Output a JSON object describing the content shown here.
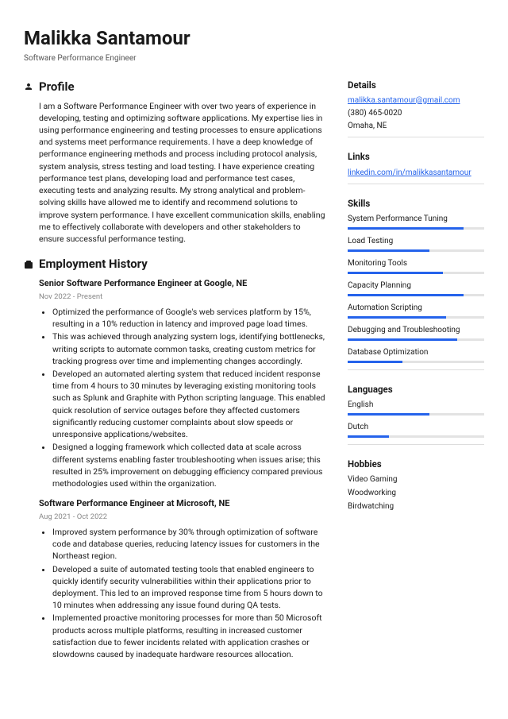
{
  "header": {
    "name": "Malikka Santamour",
    "title": "Software Performance Engineer"
  },
  "profile": {
    "heading": "Profile",
    "text": "I am a Software Performance Engineer with over two years of experience in developing, testing and optimizing software applications. My expertise lies in using performance engineering and testing processes to ensure applications and systems meet performance requirements. I have a deep knowledge of performance engineering methods and process including protocol analysis, system analysis, stress testing and load testing. I have experience creating performance test plans, developing load and performance test cases, executing tests and analyzing results. My strong analytical and problem-solving skills have allowed me to identify and recommend solutions to improve system performance. I have excellent communication skills, enabling me to effectively collaborate with developers and other stakeholders to ensure successful performance testing."
  },
  "employment": {
    "heading": "Employment History",
    "jobs": [
      {
        "title": "Senior Software Performance Engineer at Google, NE",
        "dates": "Nov 2022 - Present",
        "bullets": [
          "Optimized the performance of Google's web services platform by 15%, resulting in a 10% reduction in latency and improved page load times.",
          "This was achieved through analyzing system logs, identifying bottlenecks, writing scripts to automate common tasks, creating custom metrics for tracking progress over time and implementing changes accordingly.",
          "Developed an automated alerting system that reduced incident response time from 4 hours to 30 minutes by leveraging existing monitoring tools such as Splunk and Graphite with Python scripting language. This enabled quick resolution of service outages before they affected customers significantly reducing customer complaints about slow speeds or unresponsive applications/websites.",
          "Designed a logging framework which collected data at scale across different systems enabling faster troubleshooting when issues arise; this resulted in 25% improvement on debugging efficiency compared previous methodologies used within the organization."
        ]
      },
      {
        "title": "Software Performance Engineer at Microsoft, NE",
        "dates": "Aug 2021 - Oct 2022",
        "bullets": [
          "Improved system performance by 30% through optimization of software code and database queries, reducing latency issues for customers in the Northeast region.",
          "Developed a suite of automated testing tools that enabled engineers to quickly identify security vulnerabilities within their applications prior to deployment. This led to an improved response time from 5 hours down to 10 minutes when addressing any issue found during QA tests.",
          "Implemented proactive monitoring processes for more than 50 Microsoft products across multiple platforms, resulting in increased customer satisfaction due to fewer incidents related with application crashes or slowdowns caused by inadequate hardware resources allocation."
        ]
      }
    ]
  },
  "details": {
    "heading": "Details",
    "email": "malikka.santamour@gmail.com",
    "phone": "(380) 465-0020",
    "location": "Omaha, NE"
  },
  "links": {
    "heading": "Links",
    "items": [
      {
        "text": "linkedin.com/in/malikkasantamour"
      }
    ]
  },
  "skills": {
    "heading": "Skills",
    "items": [
      {
        "name": "System Performance Tuning",
        "level": 85
      },
      {
        "name": "Load Testing",
        "level": 60
      },
      {
        "name": "Monitoring Tools",
        "level": 70
      },
      {
        "name": "Capacity Planning",
        "level": 85
      },
      {
        "name": "Automation Scripting",
        "level": 72
      },
      {
        "name": "Debugging and Troubleshooting",
        "level": 80
      },
      {
        "name": "Database Optimization",
        "level": 40
      }
    ]
  },
  "languages": {
    "heading": "Languages",
    "items": [
      {
        "name": "English",
        "level": 60
      },
      {
        "name": "Dutch",
        "level": 30
      }
    ]
  },
  "hobbies": {
    "heading": "Hobbies",
    "items": [
      "Video Gaming",
      "Woodworking",
      "Birdwatching"
    ]
  }
}
